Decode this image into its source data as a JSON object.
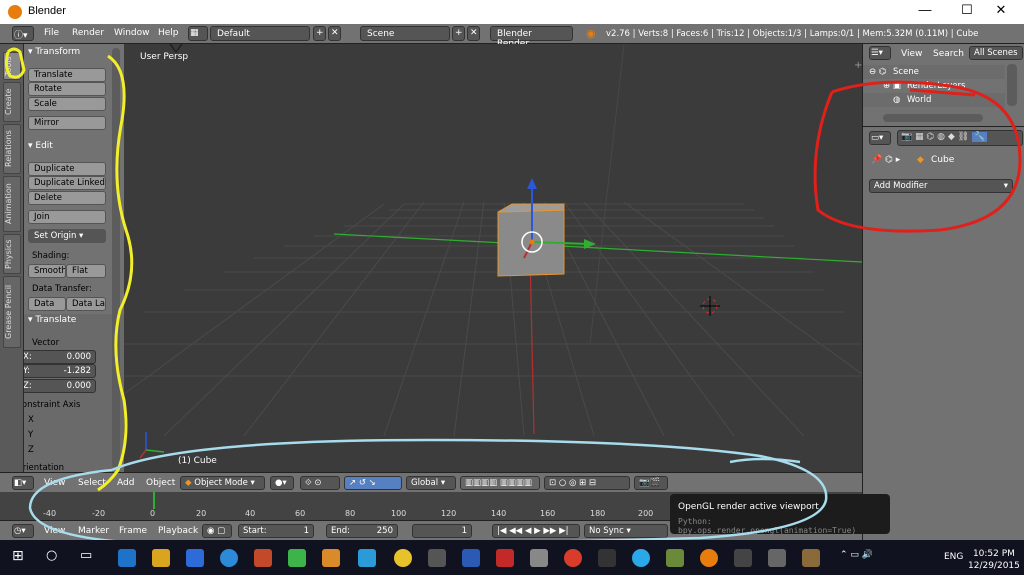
{
  "window": {
    "title": "Blender",
    "minimize": "—",
    "maximize": "☐",
    "close": "✕"
  },
  "menubar": {
    "menus": [
      "File",
      "Render",
      "Window",
      "Help"
    ],
    "layout": "Default",
    "scene": "Scene",
    "engine": "Blender Render",
    "info": "v2.76 | Verts:8 | Faces:6 | Tris:12 | Objects:1/3 | Lamps:0/1 | Mem:5.32M (0.11M) | Cube"
  },
  "tabs": [
    "Tools",
    "Create",
    "Relations",
    "Animation",
    "Physics",
    "Grease Pencil"
  ],
  "toolshelf": {
    "transform": {
      "header": "Transform",
      "buttons": [
        "Translate",
        "Rotate",
        "Scale",
        "Mirror"
      ]
    },
    "edit": {
      "header": "Edit",
      "buttons": [
        "Duplicate",
        "Duplicate Linked",
        "Delete",
        "Join"
      ],
      "set_origin": "Set Origin"
    },
    "shading": {
      "label": "Shading:",
      "smooth": "Smooth",
      "flat": "Flat"
    },
    "data_transfer": {
      "label": "Data Transfer:",
      "data": "Data",
      "data_lay": "Data Lay"
    },
    "translate": {
      "header": "Translate",
      "vector_label": "Vector",
      "x_label": "X:",
      "x_value": "0.000",
      "y_label": "Y:",
      "y_value": "-1.282",
      "z_label": "Z:",
      "z_value": "0.000",
      "constraint_label": "Constraint Axis",
      "axes": [
        {
          "name": "X",
          "checked": false
        },
        {
          "name": "Y",
          "checked": true
        },
        {
          "name": "Z",
          "checked": false
        }
      ],
      "orientation_label": "Orientation"
    }
  },
  "viewport": {
    "view_label": "User Persp",
    "object_label": "(1) Cube"
  },
  "viewport_header": {
    "menus": [
      "View",
      "Select",
      "Add",
      "Object"
    ],
    "mode": "Object Mode",
    "orientation": "Global"
  },
  "timeline": {
    "ticks": [
      "-40",
      "-20",
      "0",
      "20",
      "40",
      "60",
      "80",
      "100",
      "120",
      "140",
      "160",
      "180",
      "200"
    ],
    "current_frame": "1",
    "menus": [
      "View",
      "Marker",
      "Frame",
      "Playback"
    ],
    "start_label": "Start:",
    "start_value": "1",
    "end_label": "End:",
    "end_value": "250",
    "frame_value": "1",
    "sync": "No Sync"
  },
  "outliner": {
    "view": "View",
    "search": "Search",
    "all_scenes": "All Scenes",
    "items": [
      "Scene",
      "RenderLayers",
      "World"
    ]
  },
  "properties": {
    "object_name": "Cube",
    "add_modifier": "Add Modifier"
  },
  "tooltip": {
    "title": "OpenGL render active viewport",
    "python": "Python: bpy.ops.render.opengl(animation=True)"
  },
  "taskbar": {
    "time": "10:52 PM",
    "date": "12/29/2015",
    "lang": "ENG"
  },
  "colors": {
    "accent_orange": "#e87d0d",
    "annotation_yellow": "#f2ef2a",
    "annotation_red": "#e0201a",
    "annotation_blue": "#a8dcec",
    "x_axis": "#b33030",
    "y_axis": "#2fae2f",
    "z_axis": "#2a58d8"
  }
}
